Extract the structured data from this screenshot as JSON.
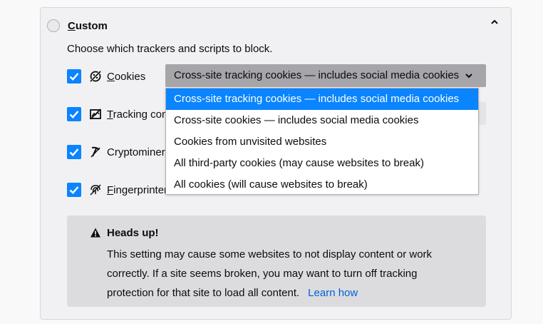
{
  "section": {
    "title_first": "C",
    "title_rest": "ustom",
    "intro": "Choose which trackers and scripts to block."
  },
  "trackers": [
    {
      "underline": "C",
      "rest": "ookies",
      "checked": true,
      "icon": "cookie-icon"
    },
    {
      "underline": "T",
      "rest": "racking con",
      "checked": true,
      "icon": "tracking-content-icon"
    },
    {
      "underline": "",
      "rest": "Cryptominer",
      "checked": true,
      "icon": "cryptominer-icon"
    },
    {
      "underline": "F",
      "rest": "ingerprinter",
      "checked": true,
      "icon": "fingerprinter-icon"
    }
  ],
  "cookie_select": {
    "value": "Cross-site tracking cookies — includes social media cookies",
    "options": [
      "Cross-site tracking cookies — includes social media cookies",
      "Cross-site cookies — includes social media cookies",
      "Cookies from unvisited websites",
      "All third-party cookies (may cause websites to break)",
      "All cookies (will cause websites to break)"
    ],
    "selected_index": 0
  },
  "warning": {
    "title": "Heads up!",
    "line1": "This setting may cause some websites to not display content or work",
    "line2": "correctly. If a site seems broken, you may want to turn off tracking",
    "line3": "protection for that site to load all content.",
    "link": "Learn how"
  },
  "colors": {
    "accent": "#0a84ff",
    "link": "#0060df"
  }
}
